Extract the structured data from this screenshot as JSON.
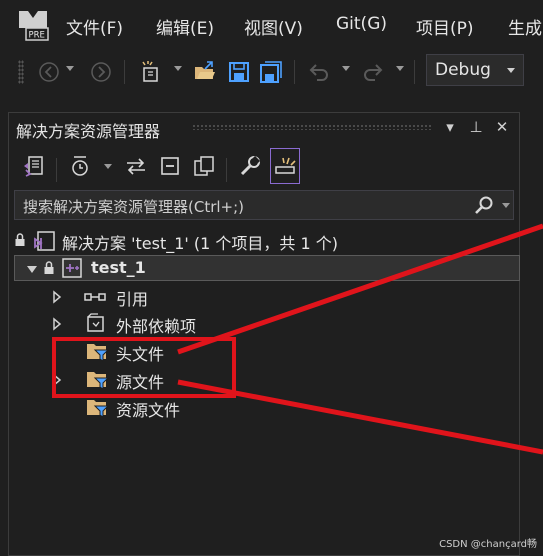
{
  "menu": {
    "items": [
      {
        "label": "文件(F)"
      },
      {
        "label": "编辑(E)"
      },
      {
        "label": "视图(V)"
      },
      {
        "label": "Git(G)"
      },
      {
        "label": "项目(P)"
      },
      {
        "label": "生成"
      }
    ],
    "logo_badge": "PRE"
  },
  "toolbar": {
    "config_value": "Debug",
    "icons": [
      "back-icon",
      "forward-icon",
      "new-project-icon",
      "open-folder-icon",
      "save-icon",
      "save-all-icon",
      "undo-icon",
      "redo-icon"
    ]
  },
  "panel": {
    "title": "解决方案资源管理器",
    "title_buttons": {
      "dropdown": "▾",
      "pin": "⊥",
      "close": "✕"
    },
    "search_placeholder": "搜索解决方案资源管理器(Ctrl+;)"
  },
  "tree": {
    "solution_label": "解决方案 'test_1' (1 个项目，共 1 个)",
    "project_label": "test_1",
    "items": [
      {
        "label": "引用",
        "expandable": true
      },
      {
        "label": "外部依赖项",
        "expandable": true
      },
      {
        "label": "头文件",
        "expandable": false
      },
      {
        "label": "源文件",
        "expandable": true
      },
      {
        "label": "资源文件",
        "expandable": false
      }
    ]
  },
  "annotation_color": "#e0141b",
  "watermark": "CSDN @chançard畅"
}
